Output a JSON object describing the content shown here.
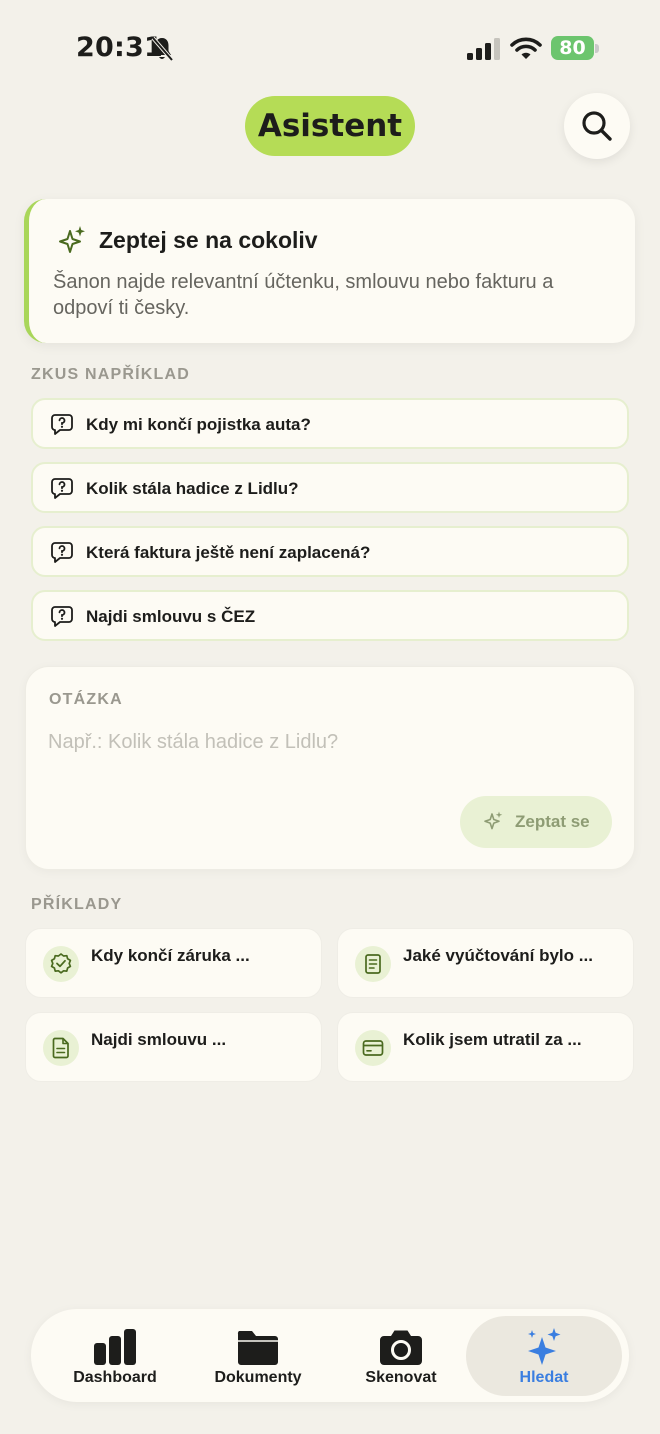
{
  "status_bar": {
    "time": "20:31",
    "battery": "80",
    "icons": [
      "bell-slash-icon",
      "signal-icon",
      "wifi-icon",
      "battery-icon"
    ]
  },
  "header": {
    "title": "Asistent",
    "search_icon": "search-icon"
  },
  "intro": {
    "title": "Zeptej se na cokoliv",
    "text": "Šanon najde relevantní účtenku, smlouvu nebo fakturu a odpoví ti česky.",
    "icon": "sparkles-icon"
  },
  "suggestions": {
    "label": "ZKUS NAPŘÍKLAD",
    "items": [
      "Kdy mi končí pojistka auta?",
      "Kolik stála hadice z Lidlu?",
      "Která faktura ještě není zaplacená?",
      "Najdi smlouvu s ČEZ"
    ],
    "icon": "question-bubble-icon"
  },
  "question": {
    "label": "OTÁZKA",
    "placeholder": "Např.: Kolik stála hadice z Lidlu?",
    "value": "",
    "ask_label": "Zeptat se"
  },
  "examples": {
    "label": "PŘÍKLADY",
    "items": [
      {
        "text": "Kdy končí záruka ...",
        "icon": "badge-check-icon"
      },
      {
        "text": "Jaké vyúčtování bylo ...",
        "icon": "receipt-icon"
      },
      {
        "text": "Najdi smlouvu ...",
        "icon": "document-icon"
      },
      {
        "text": "Kolik jsem utratil za ...",
        "icon": "credit-card-icon"
      }
    ]
  },
  "tabs": [
    {
      "label": "Dashboard",
      "icon": "bar-chart-icon",
      "active": false
    },
    {
      "label": "Dokumenty",
      "icon": "folder-icon",
      "active": false
    },
    {
      "label": "Skenovat",
      "icon": "camera-icon",
      "active": false
    },
    {
      "label": "Hledat",
      "icon": "sparkles-icon",
      "active": true
    }
  ],
  "colors": {
    "background": "#f3f1ea",
    "accent": "#b5dc56",
    "active_tab": "#3a7ee0",
    "battery": "#6cc56e"
  }
}
